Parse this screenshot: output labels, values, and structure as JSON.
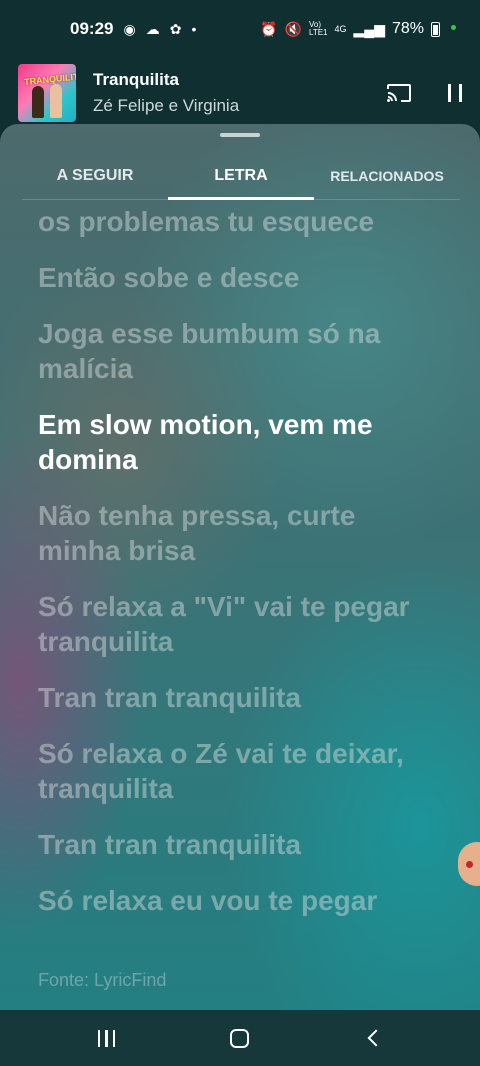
{
  "status_bar": {
    "time": "09:29",
    "network": "Vo)\nLTE1",
    "net_type": "4G",
    "battery": "78%"
  },
  "player": {
    "title": "Tranquilita",
    "artist": "Zé Felipe e Virginia",
    "album_art_text": "TRANQUILITA"
  },
  "tabs": [
    {
      "label": "A SEGUIR",
      "active": false
    },
    {
      "label": "LETRA",
      "active": true
    },
    {
      "label": "RELACIONADOS",
      "active": false
    }
  ],
  "lyrics": [
    "os problemas tu esquece",
    "Então sobe e desce",
    "Joga esse bumbum só na malícia",
    "Em slow motion, vem me domina",
    "Não tenha pressa, curte minha brisa",
    "Só relaxa a \"Vi\" vai te pegar tranquilita",
    "Tran tran tranquilita",
    "Só relaxa o Zé vai te deixar, tranquilita",
    "Tran tran tranquilita",
    "Só relaxa eu vou te pegar"
  ],
  "current_line_index": 3,
  "source": "Fonte: LyricFind",
  "icons": {
    "cast": "cast-icon",
    "pause": "pause-icon",
    "recents": "recent-apps-icon",
    "home": "home-icon",
    "back": "back-icon"
  }
}
